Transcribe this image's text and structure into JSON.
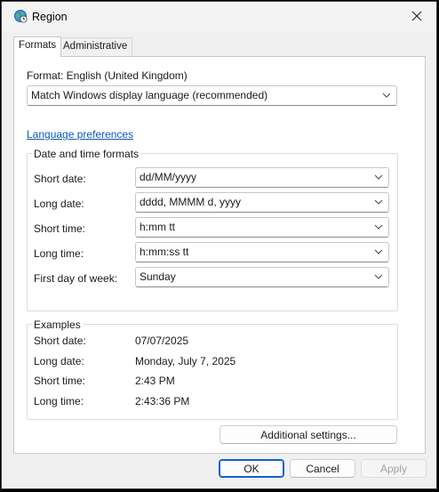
{
  "window": {
    "title": "Region"
  },
  "tabs": [
    {
      "label": "Formats",
      "selected": true
    },
    {
      "label": "Administrative",
      "selected": false
    }
  ],
  "format": {
    "label": "Format: English (United Kingdom)",
    "selected": "Match Windows display language (recommended)"
  },
  "language_preferences_link": "Language preferences",
  "date_time_formats": {
    "title": "Date and time formats",
    "rows": [
      {
        "label": "Short date:",
        "value": "dd/MM/yyyy"
      },
      {
        "label": "Long date:",
        "value": "dddd, MMMM d, yyyy"
      },
      {
        "label": "Short time:",
        "value": "h:mm tt"
      },
      {
        "label": "Long time:",
        "value": "h:mm:ss tt"
      },
      {
        "label": "First day of week:",
        "value": "Sunday"
      }
    ]
  },
  "examples": {
    "title": "Examples",
    "rows": [
      {
        "label": "Short date:",
        "value": "07/07/2025"
      },
      {
        "label": "Long date:",
        "value": "Monday, July 7, 2025"
      },
      {
        "label": "Short time:",
        "value": "2:43 PM"
      },
      {
        "label": "Long time:",
        "value": "2:43:36 PM"
      }
    ]
  },
  "buttons": {
    "additional_settings": "Additional settings...",
    "ok": "OK",
    "cancel": "Cancel",
    "apply": "Apply",
    "apply_enabled": false
  },
  "colors": {
    "link": "#0b58b8",
    "ok_border": "#0f62c7"
  },
  "icons": {
    "app": "globe-clock-icon",
    "close": "close-icon",
    "dropdown": "chevron-down-icon"
  }
}
